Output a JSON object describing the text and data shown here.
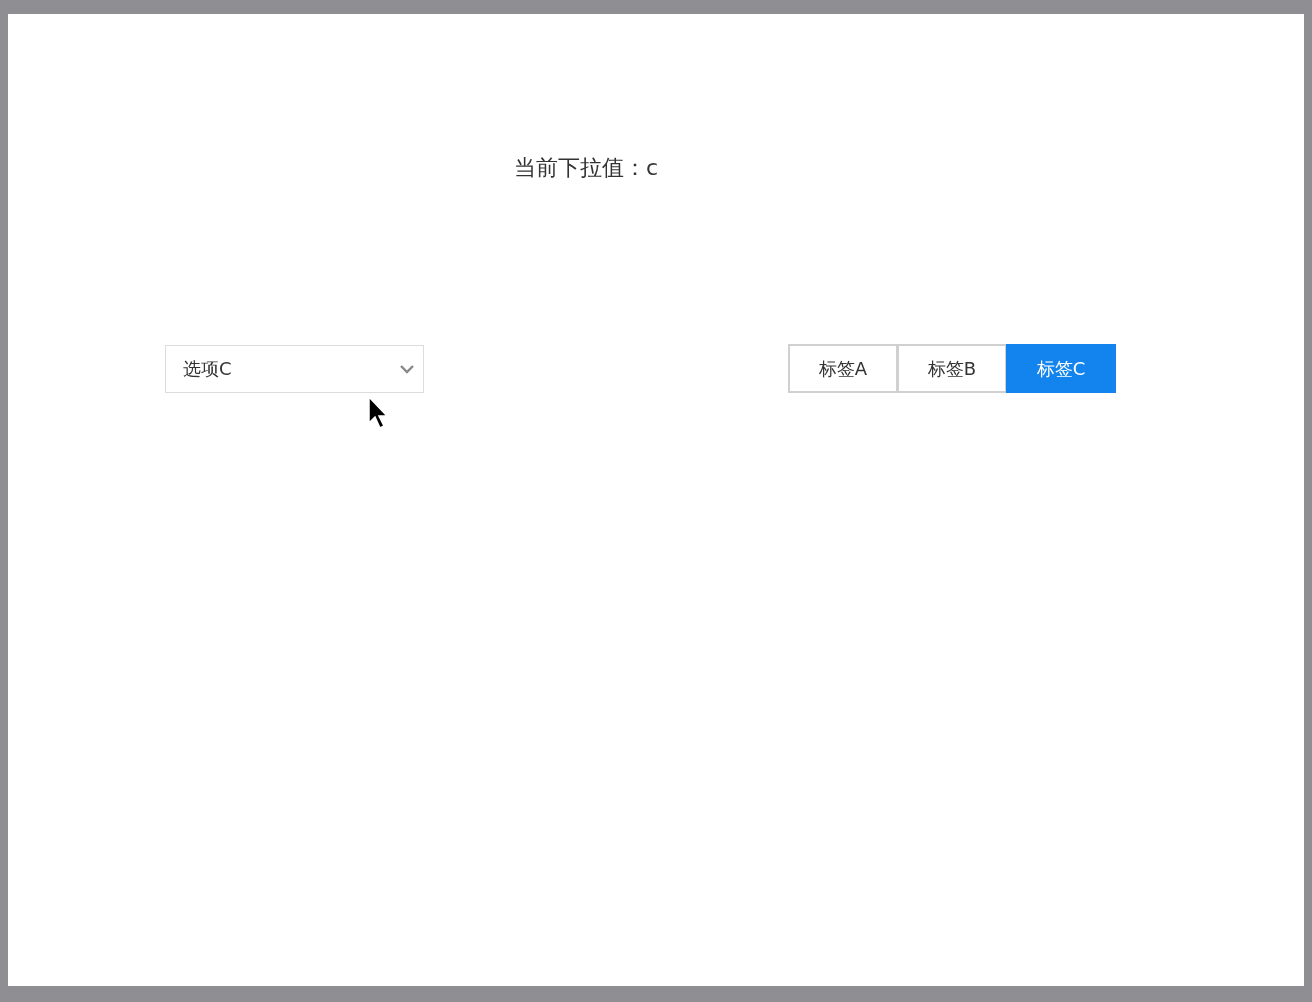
{
  "current_value": {
    "label": "当前下拉值：",
    "value": "c"
  },
  "dropdown": {
    "value": "选项C"
  },
  "tabs": [
    {
      "label": "标签A",
      "selected": false
    },
    {
      "label": "标签B",
      "selected": false
    },
    {
      "label": "标签C",
      "selected": true
    }
  ]
}
